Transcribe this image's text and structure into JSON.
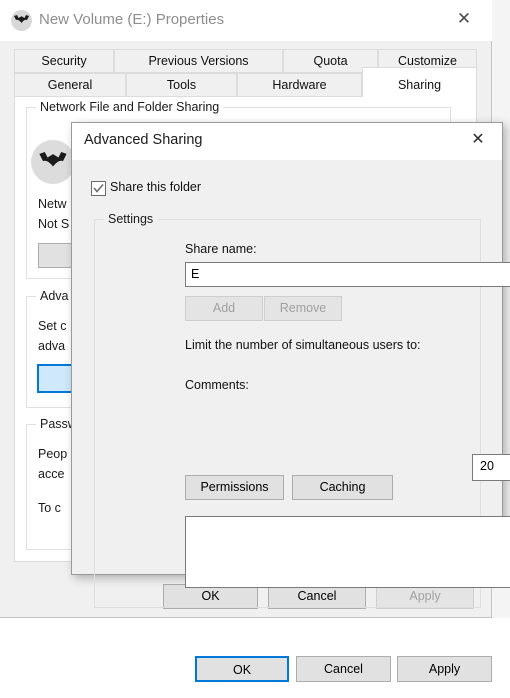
{
  "properties_window": {
    "title": "New Volume (E:) Properties",
    "icon": "bat-icon",
    "close_label": "✕",
    "tabs_row1": [
      {
        "label": "Security",
        "active": false
      },
      {
        "label": "Previous Versions",
        "active": false
      },
      {
        "label": "Quota",
        "active": false
      },
      {
        "label": "Customize",
        "active": false
      }
    ],
    "tabs_row2": [
      {
        "label": "General",
        "active": false
      },
      {
        "label": "Tools",
        "active": false
      },
      {
        "label": "Hardware",
        "active": false
      },
      {
        "label": "Sharing",
        "active": true
      }
    ],
    "sharing_page": {
      "network_group_label": "Network File and Folder Sharing",
      "share_name_line": "Netw",
      "share_status_line": "Not S",
      "advanced_group_label": "Adva",
      "advanced_text_line1": "Set c",
      "advanced_text_line2": "adva",
      "password_group_label": "Passw",
      "password_text_line1": "Peop",
      "password_text_line2": "acce",
      "password_text_line3": "To c"
    },
    "buttons": {
      "ok": "OK",
      "cancel": "Cancel",
      "apply": "Apply"
    }
  },
  "advanced_sharing_dialog": {
    "title": "Advanced Sharing",
    "close_label": "✕",
    "share_this_folder": {
      "label": "Share this folder",
      "checked": true
    },
    "settings": {
      "group_label": "Settings",
      "share_name_label": "Share name:",
      "share_name_value": "E",
      "share_name_placeholder": "",
      "add_button": "Add",
      "remove_button": "Remove",
      "limit_label": "Limit the number of simultaneous users to:",
      "limit_value": "20",
      "spin_up": "spinner-up-icon",
      "spin_down": "spinner-down-icon",
      "comments_label": "Comments:",
      "comments_value": "",
      "comments_placeholder": "",
      "permissions_button": "Permissions",
      "caching_button": "Caching"
    },
    "buttons": {
      "ok": "OK",
      "cancel": "Cancel",
      "apply": "Apply"
    }
  },
  "colors": {
    "accent": "#0078d7",
    "window_face": "#f0f0f0",
    "button_face": "#e1e1e1",
    "disabled_text": "#a0a0a0"
  }
}
